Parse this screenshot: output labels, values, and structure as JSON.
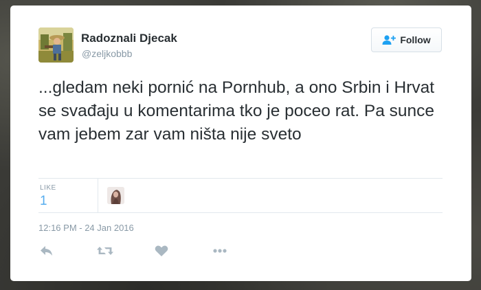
{
  "tweet": {
    "author_name": "Radoznali Djecak",
    "handle": "@zeljkobbb",
    "follow_label": "Follow",
    "text": "...gledam neki pornić na Pornhub, a ono Srbin i Hrvat se svađaju u komentarima tko je poceo rat. Pa sunce vam jebem zar vam ništa nije sveto",
    "likes_label": "LIKE",
    "likes_count": "1",
    "timestamp": "12:16 PM - 24 Jan 2016"
  },
  "icons": {
    "follow": "add-user-icon",
    "reply": "reply-icon",
    "retweet": "retweet-icon",
    "like": "heart-icon",
    "more": "more-icon"
  },
  "colors": {
    "text": "#292f33",
    "muted": "#8899a6",
    "accent": "#55acee",
    "follow_icon": "#1da1f2",
    "action_icon": "#aab8c2"
  }
}
